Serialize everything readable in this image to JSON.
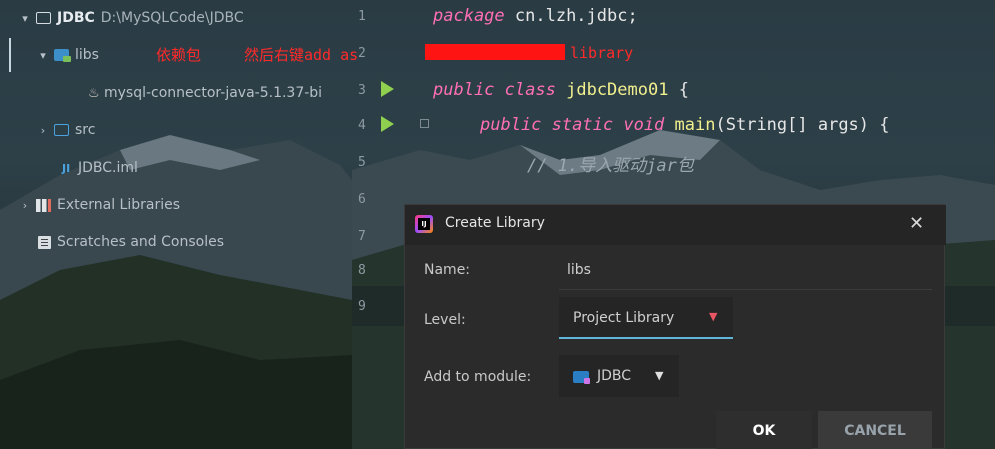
{
  "colors": {
    "annotation_red": "#ff2a2a",
    "keyword": "#ff6fb5",
    "identifier": "#f2ef8e",
    "run_icon": "#8fd14f",
    "dropdown_underline": "#5fb5d9"
  },
  "project_tree": {
    "root": {
      "label": "JDBC",
      "path": "D:\\MySQLCode\\JDBC",
      "icon": "folder-icon"
    },
    "items": [
      {
        "label": "libs",
        "icon": "library-folder-icon"
      },
      {
        "label": "mysql-connector-java-5.1.37-bi",
        "icon": "jar-icon"
      },
      {
        "label": "src",
        "icon": "source-folder-icon"
      },
      {
        "label": "JDBC.iml",
        "icon": "module-file-icon"
      },
      {
        "label": "External Libraries",
        "icon": "external-libraries-icon"
      },
      {
        "label": "Scratches and Consoles",
        "icon": "scratches-icon"
      }
    ]
  },
  "annotation": {
    "part1": "依赖包",
    "part2": "然后右键add as",
    "part3": "library"
  },
  "editor": {
    "line_numbers": [
      "1",
      "2",
      "3",
      "4",
      "5",
      "6",
      "7",
      "8",
      "9"
    ],
    "line1": {
      "kw": "package",
      "rest": " cn.lzh.jdbc;"
    },
    "line3": {
      "kw1": "public",
      "kw2": "class",
      "name": "jdbcDemo01",
      "brace": " {"
    },
    "line4": {
      "kw1": "public",
      "kw2": "static",
      "kw3": "void",
      "name": "main",
      "args": "(String[] args) {"
    },
    "line5": {
      "comment": "// 1.导入驱动jar包"
    }
  },
  "dialog": {
    "title": "Create Library",
    "close_symbol": "✕",
    "name_label": "Name:",
    "name_value": "libs",
    "level_label": "Level:",
    "level_value": "Project Library",
    "module_label": "Add to module:",
    "module_value": "JDBC",
    "dropdown_caret": "▼",
    "ok_label": "OK",
    "cancel_label": "CANCEL"
  }
}
